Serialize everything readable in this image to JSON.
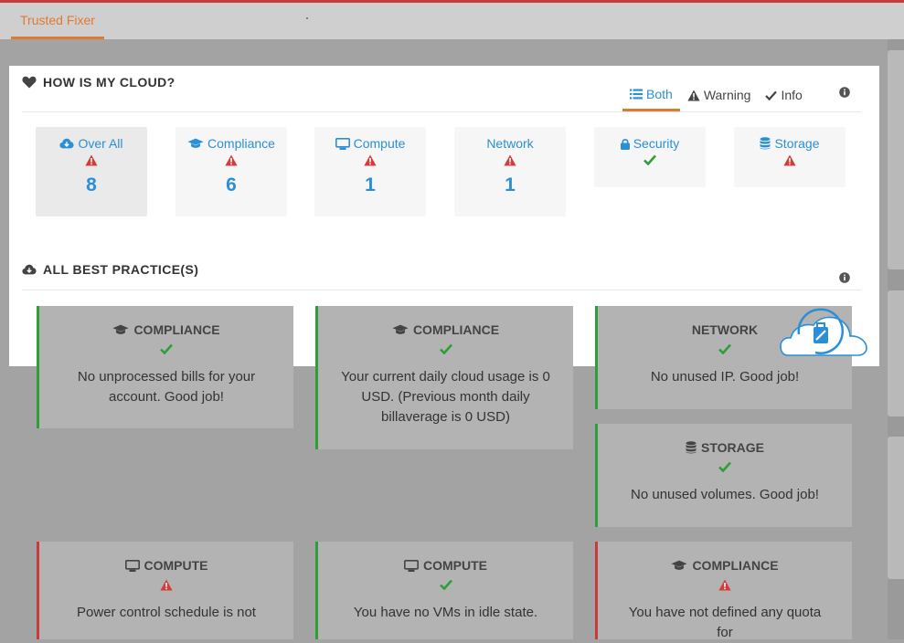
{
  "tabbar": {
    "active_tab": "Trusted Fixer"
  },
  "cloud_status": {
    "title": "HOW IS MY CLOUD?",
    "filters": [
      {
        "label": "Both",
        "icon": "list-icon",
        "active": true
      },
      {
        "label": "Warning",
        "icon": "warning-icon",
        "active": false
      },
      {
        "label": "Info",
        "icon": "check-icon",
        "active": false
      }
    ],
    "summary": [
      {
        "label": "Over All",
        "icon": "cloud-download-icon",
        "status": "warning",
        "count": "8"
      },
      {
        "label": "Compliance",
        "icon": "graduation-cap-icon",
        "status": "warning",
        "count": "6"
      },
      {
        "label": "Compute",
        "icon": "monitor-icon",
        "status": "warning",
        "count": "1"
      },
      {
        "label": "Network",
        "icon": "",
        "status": "warning",
        "count": "1"
      },
      {
        "label": "Security",
        "icon": "lock-icon",
        "status": "ok",
        "count": ""
      },
      {
        "label": "Storage",
        "icon": "database-icon",
        "status": "warning",
        "count": ""
      }
    ]
  },
  "best_practices": {
    "title": "ALL BEST PRACTICE(S)",
    "cards": [
      {
        "category": "COMPLIANCE",
        "icon": "graduation-cap-icon",
        "status": "ok",
        "message": "No unprocessed bills for your account. Good job!"
      },
      {
        "category": "COMPLIANCE",
        "icon": "graduation-cap-icon",
        "status": "ok",
        "message": "Your current daily cloud usage is 0 USD. (Previous month daily billaverage is 0 USD)"
      },
      {
        "category": "NETWORK",
        "icon": "",
        "status": "ok",
        "message": "No unused IP. Good job!"
      },
      {
        "category": "STORAGE",
        "icon": "database-icon",
        "status": "ok",
        "message": "No unused volumes. Good job!"
      },
      {
        "category": "COMPUTE",
        "icon": "monitor-icon",
        "status": "warning",
        "message": "Power control schedule is not"
      },
      {
        "category": "COMPUTE",
        "icon": "monitor-icon",
        "status": "ok",
        "message": "You have no VMs in idle state."
      },
      {
        "category": "COMPLIANCE",
        "icon": "graduation-cap-icon",
        "status": "warning",
        "message": "You have not defined any quota for"
      }
    ]
  },
  "colors": {
    "accent": "#2b8fd6",
    "tab_underline": "#e07a2f",
    "ok": "#2f9e38",
    "warning": "#d63b3b"
  }
}
